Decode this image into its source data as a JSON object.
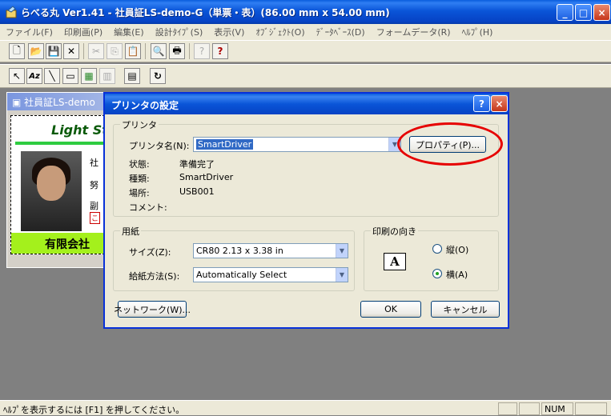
{
  "app": {
    "title": "らべる丸 Ver1.41 - 社員証LS-demo-G（単票・表）(86.00 mm x 54.00 mm)",
    "window_buttons": [
      "_",
      "□",
      "×"
    ]
  },
  "menu": [
    "ファイル(F)",
    "印刷画(P)",
    "編集(E)",
    "設計ﾀｲﾌﾟ(S)",
    "表示(V)",
    "ｵﾌﾞｼﾞｪｸﾄ(O)",
    "ﾃﾞｰﾀﾍﾞｰｽ(D)",
    "フォームデータ(R)",
    "ﾍﾙﾌﾟ(H)"
  ],
  "toolbar1": [
    "🗋",
    "📂",
    "💾",
    "✕",
    "✂",
    "⎘",
    "📋",
    "🔍",
    "🖶",
    "?",
    "?"
  ],
  "toolbar2": [
    "↖",
    "Az",
    "╲",
    "▭",
    "▦",
    "▥",
    "▤",
    "↻"
  ],
  "doc": {
    "title": "社員証LS-demo",
    "logo": "Light Sto",
    "text1": "社",
    "text2": "努",
    "text3": "副",
    "text4": "こ",
    "company": "有限会社"
  },
  "dialog": {
    "title": "プリンタの設定",
    "help_btn": "?",
    "close_btn": "×",
    "printer_group": "プリンタ",
    "printer_name_label": "プリンタ名(N):",
    "printer_name_value": "SmartDriver",
    "properties_button": "プロパティ(P)...",
    "status_label": "状態:",
    "status_value": "準備完了",
    "type_label": "種類:",
    "type_value": "SmartDriver",
    "location_label": "場所:",
    "location_value": "USB001",
    "comment_label": "コメント:",
    "paper_group": "用紙",
    "size_label": "サイズ(Z):",
    "size_value": "CR80 2.13 x 3.38 in",
    "source_label": "給紙方法(S):",
    "source_value": "Automatically Select",
    "orientation_group": "印刷の向き",
    "orient_icon": "A",
    "portrait_label": "縦(O)",
    "landscape_label": "横(A)",
    "orientation_selected": "landscape",
    "network_button": "ネットワーク(W)...",
    "ok_button": "OK",
    "cancel_button": "キャンセル"
  },
  "status": {
    "text": "ﾍﾙﾌﾟを表示するには [F1] を押してください。",
    "num": "NUM"
  },
  "colors": {
    "annotation": "#e60000",
    "title_blue": "#0a55d8",
    "card_green": "#a4f01c"
  }
}
